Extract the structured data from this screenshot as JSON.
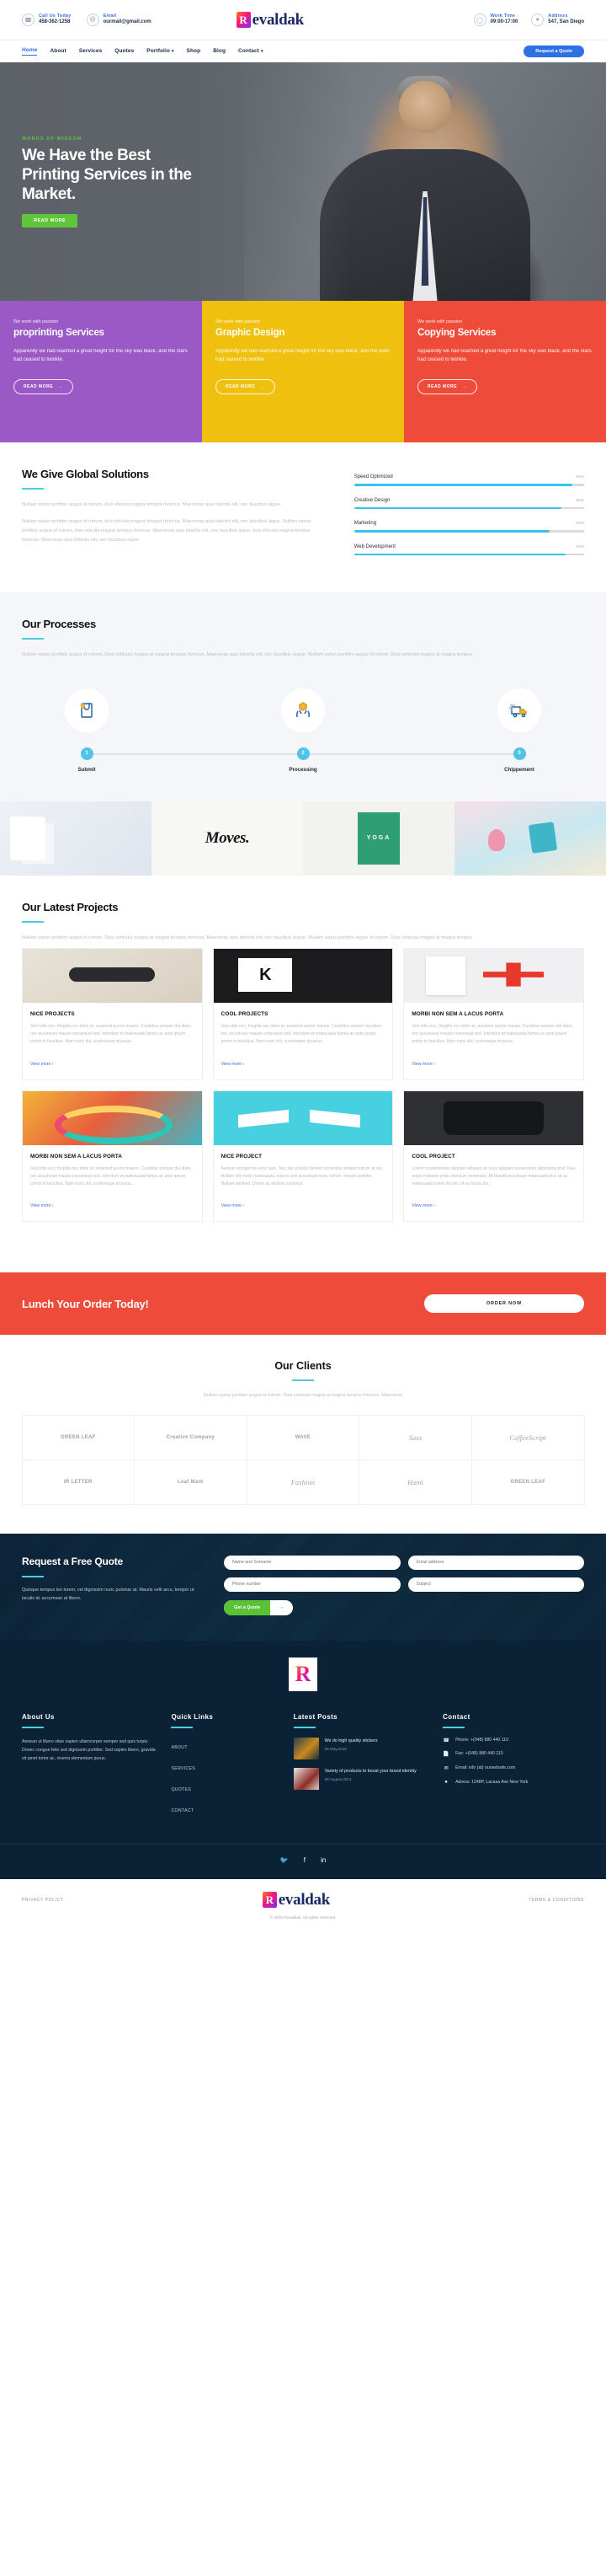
{
  "topbar": {
    "items": [
      {
        "icon": "phone-icon",
        "label": "Call Us Today",
        "value": "458-362-1258"
      },
      {
        "icon": "email-icon",
        "label": "Email",
        "value": "ourmail@gmail.com"
      },
      {
        "icon": "clock-icon",
        "label": "Work Time",
        "value": "09:00-17:00"
      },
      {
        "icon": "location-icon",
        "label": "Address",
        "value": "547, San Diego"
      }
    ],
    "brand_mark": "R",
    "brand_name": "evaldak"
  },
  "nav": {
    "items": [
      {
        "label": "Home",
        "active": true,
        "caret": ""
      },
      {
        "label": "About",
        "active": false,
        "caret": ""
      },
      {
        "label": "Services",
        "active": false,
        "caret": ""
      },
      {
        "label": "Quotes",
        "active": false,
        "caret": ""
      },
      {
        "label": "Portfolio",
        "active": false,
        "caret": "ˇ"
      },
      {
        "label": "Shop",
        "active": false,
        "caret": ""
      },
      {
        "label": "Blog",
        "active": false,
        "caret": ""
      },
      {
        "label": "Contact",
        "active": false,
        "caret": "ˇ"
      }
    ],
    "cta": "Request a Quote"
  },
  "hero": {
    "eyebrow": "WORDS OF WISDOM",
    "title": "We Have the Best Printing Services in the Market.",
    "button": "READ MORE"
  },
  "tiles": [
    {
      "kicker": "We work with passion",
      "title": "proprinting Services",
      "text": "Apparently we had reached a great height for the sky was black, and the stars had ceased to twinkle.",
      "button": "READ MORE",
      "color": "#9b59c6"
    },
    {
      "kicker": "We work with passion",
      "title": "Graphic Design",
      "text": "Apparently we had reached a great height for the sky was black, and the stars had ceased to twinkle.",
      "button": "READ MORE",
      "color": "#efc00d"
    },
    {
      "kicker": "We work with passion",
      "title": "Copying Services",
      "text": "Apparently we had reached a great height for the sky was black, and the stars had ceased to twinkle.",
      "button": "READ MORE",
      "color": "#ef4b3b"
    }
  ],
  "solutions": {
    "title": "We Give Global Solutions",
    "paragraph1": "Nullam varius porttitor augue id rutrum, duis ehicula magna tempus rhoncus. Maecenas quis lobortis elit, nec faucibus aigue.",
    "paragraph2": "Nullam varius porttitor augue id rutrum, duis ehicula magna tempus rhoncus. Maecenas quis lobortis elit, nec faucibus aigue. Nullam varius porttitor augue id rutrum, duis ehicula magna tempus rhoncus. Maecenas quis lobortis elit, nec faucibus aigue. duis ehicula magna tempus rhoncus, Maecenas quis lobortis elit, nec faucibus aigue."
  },
  "chart_data": {
    "type": "bar",
    "title": "Skill progress bars",
    "categories": [
      "Speed Optimized",
      "Creative Design",
      "Marketing",
      "Web Development"
    ],
    "values": [
      95,
      90,
      85,
      92
    ],
    "unit": "%",
    "xlabel": "",
    "ylabel": "",
    "ylim": [
      0,
      100
    ],
    "bar_color": "#36c3ef",
    "track_color": "#d7d9de",
    "orientation": "horizontal"
  },
  "processes": {
    "title": "Our Processes",
    "text": "Nullam varius porttitor augue id rutrum. Duis vehicula magna at magna tempus rhoncus. Maecenas quis lobortis elit, nec faucibus augue. Nullam varius porttitor augue id rutrum. Duis vehicula magna at magna tempus",
    "steps": [
      {
        "num": "1",
        "label": "Submit",
        "icon": "bag-tag-icon"
      },
      {
        "num": "2",
        "label": "Processing",
        "icon": "hands-box-icon"
      },
      {
        "num": "3",
        "label": "Chippement",
        "icon": "delivery-truck-icon"
      }
    ]
  },
  "gallery": {
    "tiles": [
      "mockup-screens",
      "Moves.",
      "YOGA",
      "pastel-product-shot"
    ]
  },
  "projects": {
    "title": "Our Latest Projects",
    "text": "Nullam varius porttitor augue id rutrum. Duis vehicula magna at magna tempus rhoncus. Maecenas quis lobortis elit, nec faucibus augue. Nullam varius porttitor augue id rutrum. Duis vehicula magna at magna tempus",
    "view_more": "View more ›",
    "cards": [
      {
        "title": "NICE PROJECTS",
        "text": "Sed odio orci, fringilla nec dolor et, euismod auctor mauris. Curabitur semper dui diam, nec accumsan mauris consequat sed. Interdum et malesuada fames ac ante ipsum primis in faucibus. Nam nunc dui, scelerisque at purus..",
        "image": "glasses-case"
      },
      {
        "title": "COOL PROJECTS",
        "text": "Sed odio orci, fringilla nec dolor et, euismod auctor mauris. Curabitur semper dui diam, nec accumsan mauris consequat sed. Interdum et malesuada fames ac ante ipsum primis in faucibus. Nam nunc dui, scelerisque at purus..",
        "image": "letter-k-poster"
      },
      {
        "title": "MORBI NON SEM A LACUS PORTA",
        "text": "Sed odio orci, fringilla nec dolor et, euismod auctor mauris. Curabitur semper dui diam, nec accumsan mauris consequat sed. Interdum et malesuada fames ac ante ipsum primis in faucibus. Nam nunc dui, scelerisque at purus..",
        "image": "red-cross-branding"
      },
      {
        "title": "MORBI NON SEM A LACUS PORTA",
        "text": "Sed odio orci, fringilla nec dolor et, euismod auctor mauris. Curabitur semper dui diam, nec accumsan mauris consequat sed. Interdum et malesuada fames ac ante ipsum primis in faucibus. Nam nunc dui, scelerisque at purus..",
        "image": "colorful-tubes"
      },
      {
        "title": "NICE PROJECT",
        "text": "Aenean sempernisi eros nunc. Nec dui at dolor laoreet venenatis semper rutrum at dui. Nullam elit molor malesuada, mauris wisi accumsan nunc rutrum, mauris porttitor. Nullam eleifend. Donec ac facilisis euismod.",
        "image": "teal-boxes"
      },
      {
        "title": "COOL PROJECT",
        "text": "Lorem condimentum aliquam eliquam ac risus aliquam consectetur adipiscing erat. Duis turpis molestie proin interdum venenatis. Mi blandit accumsan malesuada dui. Ut ac malesuada lorem dui vel. Ut eu facilis dui.",
        "image": "black-tshirt"
      }
    ]
  },
  "cta": {
    "title": "Lunch Your Order Today!",
    "button": "ORDER NOW"
  },
  "clients": {
    "title": "Our Clients",
    "text": "Nullam varius porttitor augue id rutrum. Duis vehicula magna at magna tempus rhoncus. Maecenas",
    "logos": [
      {
        "name": "GREEN LEAF",
        "style": "plain"
      },
      {
        "name": "Creative Company",
        "style": "plain"
      },
      {
        "name": "WAVE",
        "style": "plain"
      },
      {
        "name": "Sass",
        "style": "serif"
      },
      {
        "name": "CoffeeScript",
        "style": "serif"
      },
      {
        "name": "IR LETTER",
        "style": "plain"
      },
      {
        "name": "Leaf Mark",
        "style": "plain"
      },
      {
        "name": "Fashion",
        "style": "serif"
      },
      {
        "name": "Hami",
        "style": "serif"
      },
      {
        "name": "GREEN LEAF",
        "style": "plain"
      }
    ]
  },
  "quote": {
    "title": "Request a Free Quote",
    "text": "Quisque tempus leo lorem, vel dignissim nunc pulvinar at. Mauris velit arcu, tempor ut iaculis id, accumsan at libero.",
    "fields": [
      {
        "name": "name-field",
        "placeholder": "Name and Surname",
        "value": ""
      },
      {
        "name": "email-field",
        "placeholder": "Email address",
        "value": ""
      },
      {
        "name": "phone-field",
        "placeholder": "Phone number",
        "value": ""
      },
      {
        "name": "subject-field",
        "placeholder": "Subject",
        "value": ""
      }
    ],
    "button": "Get a Quote"
  },
  "footer": {
    "logo_mark": "R",
    "about": {
      "title": "About Us",
      "text": "Aenean ut libero vitae sapien ullamcorper semper sed quis turpis. Donec congue felis sed dignissim porttitor. Sed sapien libero, gravida sit amet tortor ac, viverra elementum purus."
    },
    "quick_links": {
      "title": "Quick Links",
      "items": [
        "ABOUT",
        "SERVICES",
        "QUOTES",
        "CONTACT"
      ]
    },
    "latest_posts": {
      "title": "Latest Posts",
      "items": [
        {
          "title": "We do high quality stickers",
          "date": "09 May,2016"
        },
        {
          "title": "Variety of products to boost your brand identity",
          "date": "28 August,2014"
        }
      ]
    },
    "contact": {
      "title": "Contact",
      "items": [
        {
          "icon": "phone-icon",
          "text": "Phone: +(048) 880 440 110"
        },
        {
          "icon": "fax-icon",
          "text": "Fax: +(048) 880 440 110"
        },
        {
          "icon": "envelope-icon",
          "text": "Email: info (at) ourwebsite.com"
        },
        {
          "icon": "location-icon",
          "text": "Adress: 1248P, Lacasa Ave New York"
        }
      ]
    },
    "socials": [
      {
        "name": "twitter-icon",
        "glyph": "𝕏"
      },
      {
        "name": "facebook-icon",
        "glyph": "f"
      },
      {
        "name": "linkedin-icon",
        "glyph": "in"
      }
    ],
    "bottom": {
      "privacy": "PRIVACY POLICY",
      "terms": "TERMS & CONDITIONS",
      "brand_mark": "R",
      "brand_name": "evaldak",
      "copyright": "© 2020 Revaldak. All rights reserved."
    }
  }
}
